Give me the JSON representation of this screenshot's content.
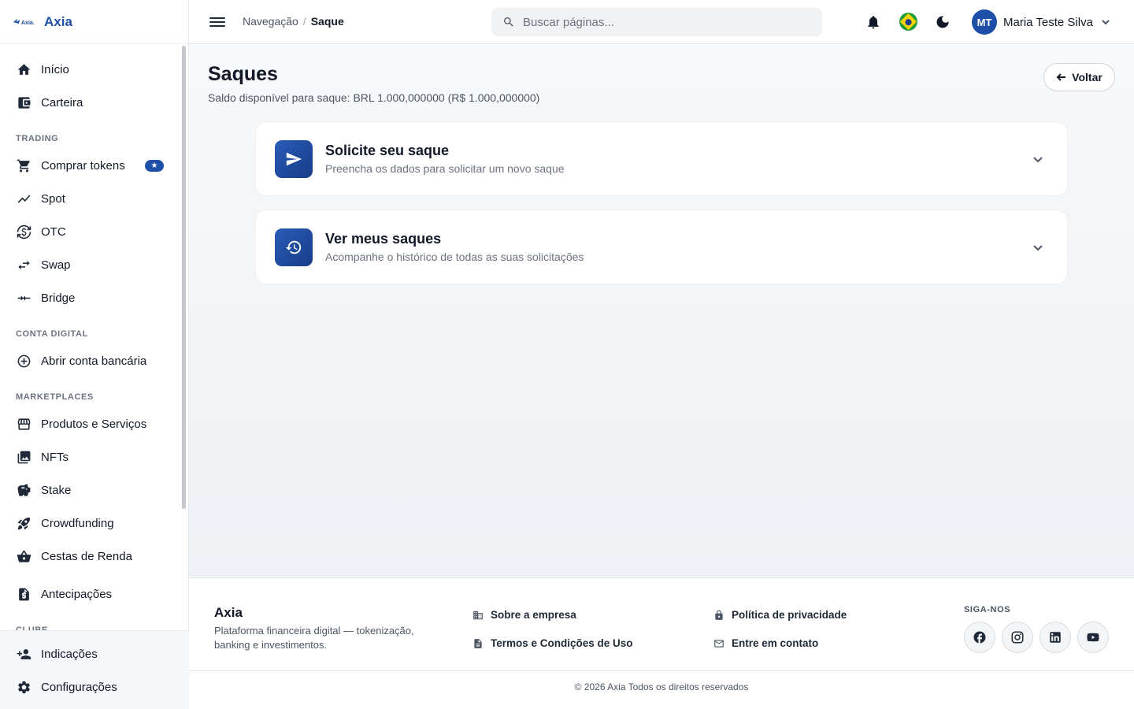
{
  "brand": {
    "logo_text": "Axia.",
    "name": "Axia"
  },
  "sidebar": {
    "items": [
      {
        "label": "Início",
        "icon": "home-icon"
      },
      {
        "label": "Carteira",
        "icon": "wallet-icon"
      }
    ],
    "sections": [
      {
        "title": "TRADING",
        "items": [
          {
            "label": "Comprar tokens",
            "icon": "cart-icon",
            "badge": "star"
          },
          {
            "label": "Spot",
            "icon": "trend-icon"
          },
          {
            "label": "OTC",
            "icon": "currency-exchange-icon"
          },
          {
            "label": "Swap",
            "icon": "swap-icon"
          },
          {
            "label": "Bridge",
            "icon": "bridge-icon"
          }
        ]
      },
      {
        "title": "CONTA DIGITAL",
        "items": [
          {
            "label": "Abrir conta bancária",
            "icon": "add-circle-icon"
          }
        ]
      },
      {
        "title": "MARKETPLACES",
        "items": [
          {
            "label": "Produtos e Serviços",
            "icon": "store-icon"
          },
          {
            "label": "NFTs",
            "icon": "image-gallery-icon"
          },
          {
            "label": "Stake",
            "icon": "piggy-bank-icon"
          },
          {
            "label": "Crowdfunding",
            "icon": "rocket-icon"
          },
          {
            "label": "Cestas de Renda",
            "icon": "basket-icon"
          },
          {
            "label": "Antecipações",
            "icon": "document-money-icon"
          }
        ]
      },
      {
        "title": "CLUBE",
        "items": []
      }
    ],
    "bottom_items": [
      {
        "label": "Indicações",
        "icon": "person-add-icon"
      },
      {
        "label": "Configurações",
        "icon": "gear-icon"
      }
    ]
  },
  "topbar": {
    "breadcrumb": {
      "root": "Navegação",
      "separator": "/",
      "current": "Saque"
    },
    "search_placeholder": "Buscar páginas...",
    "user": {
      "initials": "MT",
      "name": "Maria Teste Silva"
    }
  },
  "page": {
    "title": "Saques",
    "subtitle": "Saldo disponível para saque: BRL 1.000,000000 (R$ 1.000,000000)",
    "back_label": "Voltar",
    "cards": [
      {
        "title": "Solicite seu saque",
        "description": "Preencha os dados para solicitar um novo saque",
        "icon": "send-icon"
      },
      {
        "title": "Ver meus saques",
        "description": "Acompanhe o histórico de todas as suas solicitações",
        "icon": "history-icon"
      }
    ]
  },
  "footer": {
    "brand": "Axia",
    "description": "Plataforma financeira digital — tokenização, banking e investimentos.",
    "links": {
      "about": "Sobre a empresa",
      "terms": "Termos e Condições de Uso",
      "privacy": "Política de privacidade",
      "contact": "Entre em contato"
    },
    "follow_title": "SIGA-NOS",
    "socials": [
      "facebook-icon",
      "instagram-icon",
      "linkedin-icon",
      "youtube-icon"
    ],
    "copyright": "© 2026 Axia Todos os direitos reservados"
  },
  "colors": {
    "accent": "#1e4fa8",
    "card_icon": "#1f4a9c",
    "brand_text": "#1e4fa8"
  }
}
